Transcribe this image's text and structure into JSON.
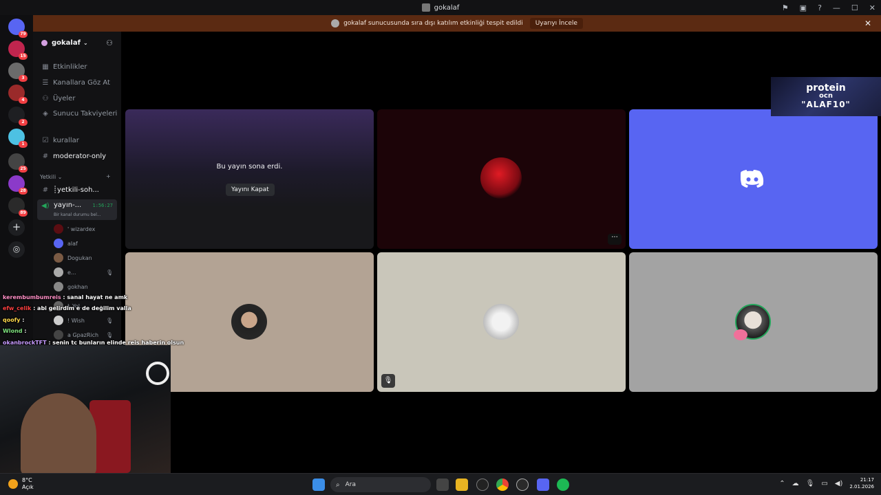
{
  "window": {
    "title": "gokalaf"
  },
  "banner": {
    "text": "gokalaf sunucusunda sıra dışı katılım etkinliği tespit edildi",
    "button": "Uyarıyı İncele"
  },
  "guilds": [
    {
      "badge": "79",
      "color": "#5865f2"
    },
    {
      "badge": "15",
      "color": "#c0254e"
    },
    {
      "badge": "3",
      "color": "#6b6b6b"
    },
    {
      "badge": "4",
      "color": "#9a2a2a"
    },
    {
      "badge": "2",
      "color": "#1e1f22"
    },
    {
      "badge": "1",
      "color": "#4dc1e3"
    },
    {
      "badge": "25",
      "color": "#444444"
    },
    {
      "badge": "28",
      "color": "#8b3ac9"
    },
    {
      "badge": "89",
      "color": "#2a2a2a"
    }
  ],
  "server": {
    "name": "gokalaf"
  },
  "channels": {
    "menu": [
      "Etkinlikler",
      "Kanallara Göz At",
      "Üyeler",
      "Sunucu Takviyeleri"
    ],
    "rules": "kurallar",
    "moderator": "moderator-only",
    "category": "Yetkili",
    "yetkili_chat": "┊yetkili-soh...",
    "voice_name": "yayın-...",
    "voice_time": "1:56:27",
    "voice_status": "Bir kanal durumu bel...",
    "voice_users": [
      "' wizardex",
      "alaf",
      "Dogukan",
      "e...",
      "gokhan",
      "Ł Yol...",
      "! Wish",
      "a GpazRich"
    ]
  },
  "stage": {
    "ended_text": "Bu yayın sona erdi.",
    "close_button": "Yayını Kapat"
  },
  "sponsor": {
    "line1": "protein",
    "line2": "ocn",
    "line3": "\"ALAF10\""
  },
  "chat": [
    {
      "user": "kerembumbumreis",
      "text": " : sanal hayat ne amk",
      "color": "#ff8fc6"
    },
    {
      "user": "efw_celik",
      "text": " : abi gelirdim e de değilim valla",
      "color": "#ff4040"
    },
    {
      "user": "qoofy",
      "text": " :",
      "color": "#ffd84a"
    },
    {
      "user": "Wlond",
      "text": " :",
      "color": "#7ee37e"
    },
    {
      "user": "okanbrockTFT",
      "text": " : senin tc bunların elinde reis haberin olsun",
      "color": "#c79bff"
    }
  ],
  "taskbar": {
    "weather_temp": "8°C",
    "weather_desc": "Açık",
    "search_placeholder": "Ara",
    "time": "21:17",
    "date": "2.01.2026"
  }
}
